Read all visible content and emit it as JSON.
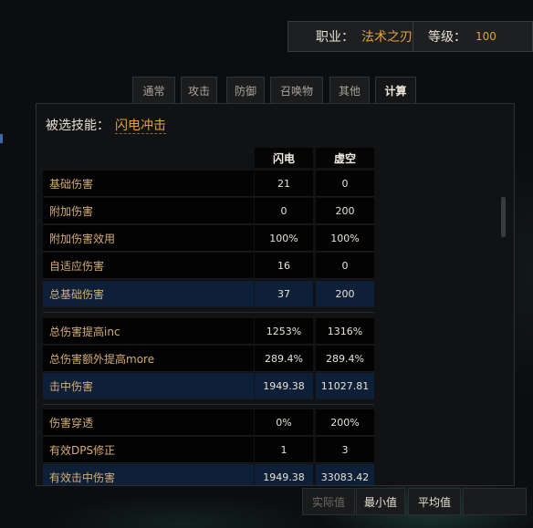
{
  "header": {
    "class_label": "职业：",
    "class_value": "法术之刃",
    "level_label": "等级：",
    "level_value": "100"
  },
  "tabs": [
    {
      "label": "通常",
      "active": false
    },
    {
      "label": "攻击",
      "active": false
    },
    {
      "label": "防御",
      "active": false
    },
    {
      "label": "召唤物",
      "active": false
    },
    {
      "label": "其他",
      "active": false
    },
    {
      "label": "计算",
      "active": true
    }
  ],
  "skill": {
    "label": "被选技能：",
    "name": "闪电冲击"
  },
  "table": {
    "columns": [
      "闪电",
      "虚空"
    ],
    "rows": [
      {
        "label": "基础伤害",
        "v1": "21",
        "v2": "0"
      },
      {
        "label": "附加伤害",
        "v1": "0",
        "v2": "200"
      },
      {
        "label": "附加伤害效用",
        "v1": "100%",
        "v2": "100%"
      },
      {
        "label": "自适应伤害",
        "v1": "16",
        "v2": "0"
      },
      {
        "label": "总基础伤害",
        "v1": "37",
        "v2": "200"
      },
      {
        "label": "总伤害提高inc",
        "v1": "1253%",
        "v2": "1316%"
      },
      {
        "label": "总伤害额外提高more",
        "v1": "289.4%",
        "v2": "289.4%"
      },
      {
        "label": "击中伤害",
        "v1": "1949.38",
        "v2": "11027.81"
      },
      {
        "label": "伤害穿透",
        "v1": "0%",
        "v2": "200%"
      },
      {
        "label": "有效DPS修正",
        "v1": "1",
        "v2": "3"
      },
      {
        "label": "有效击中伤害",
        "v1": "1949.38",
        "v2": "33083.42"
      }
    ]
  },
  "buttons": {
    "actual": "实际值",
    "min": "最小值",
    "avg": "平均值"
  },
  "colors": {
    "accent": "#e3a33a",
    "label_text": "#d4ad74",
    "highlight_row": "#0e1f38"
  }
}
